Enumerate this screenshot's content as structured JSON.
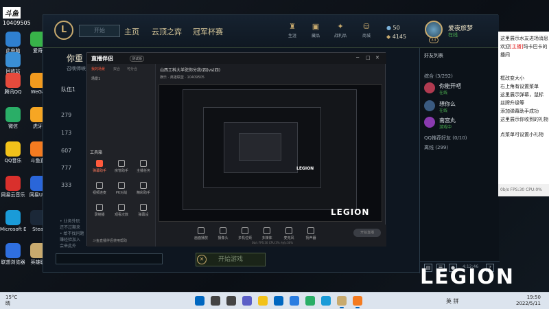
{
  "watermark": {
    "brand": "斗鱼",
    "room": "10409505"
  },
  "desktop_icons": [
    {
      "label": "此电脑",
      "icon": "pc-icon",
      "color": "#2f80d0"
    },
    {
      "label": "回收站",
      "icon": "recycle-bin-icon",
      "color": "#3a8fd6"
    },
    {
      "label": "腾讯QQ",
      "icon": "qq-icon",
      "color": "#e64a3c"
    },
    {
      "label": "微信",
      "icon": "wechat-icon",
      "color": "#2aae67"
    },
    {
      "label": "QQ音乐",
      "icon": "qqmusic-icon",
      "color": "#f2c21a"
    },
    {
      "label": "网易云音乐",
      "icon": "netease-music-icon",
      "color": "#d9302c"
    },
    {
      "label": "Microsoft Edge",
      "icon": "edge-icon",
      "color": "#1a9bd8"
    },
    {
      "label": "联想浏览器",
      "icon": "lenovo-browser-icon",
      "color": "#2f6fe0"
    },
    {
      "label": "爱奇",
      "icon": "iqiyi-icon",
      "color": "#38b349"
    },
    {
      "label": "WeGa",
      "icon": "wegame-icon",
      "color": "#f29a1e"
    },
    {
      "label": "虎牙",
      "icon": "huya-icon",
      "color": "#f6a623"
    },
    {
      "label": "斗鱼直",
      "icon": "douyu-icon",
      "color": "#f47b20"
    },
    {
      "label": "网易UU",
      "icon": "uu-icon",
      "color": "#2a66d9"
    },
    {
      "label": "Stea",
      "icon": "steam-icon",
      "color": "#1b2838"
    },
    {
      "label": "英雄联",
      "icon": "lol-icon",
      "color": "#c8aa6e"
    }
  ],
  "client": {
    "play_label": "开始",
    "nav": [
      "主页",
      "云顶之弈",
      "冠军杯赛"
    ],
    "top_icons": [
      {
        "label": "生涯",
        "icon": "profile-icon"
      },
      {
        "label": "藏品",
        "icon": "collection-icon"
      },
      {
        "label": "战利品",
        "icon": "loot-icon"
      },
      {
        "label": "商城",
        "icon": "store-icon"
      }
    ],
    "currency": {
      "be": "50",
      "rp": "4145"
    },
    "player": {
      "name": "爱夜旅梦",
      "status": "在线",
      "level": "33"
    },
    "party": {
      "title": "你重",
      "subtitle": "召唤师峡",
      "team": "队伍1",
      "numbers": [
        "279",
        "173",
        "607",
        "777",
        "333"
      ]
    },
    "party_chat": [
      "• 业务外玩",
      "还不过期来",
      "• 给不找问题",
      "赚经验加入",
      "会来此外"
    ],
    "start_label": "开始游戏",
    "friends": {
      "header": "好友列表",
      "group_general": "综合 (3/292)",
      "list": [
        {
          "name": "你能开吧",
          "status": "在线",
          "color": "#b03a50"
        },
        {
          "name": "想你么",
          "status": "在线",
          "color": "#3a5a80"
        },
        {
          "name": "南宫丸",
          "status": "游戏中",
          "color": "#8a3ab0"
        }
      ],
      "group_qq": "QQ推荐好友 (0/10)",
      "group_offline": "离线 (299)",
      "bottom_time": "4:12:46"
    }
  },
  "chat_lines": [
    {
      "text": "这里展示水友进场消息",
      "red": false
    },
    {
      "text": "欢迎",
      "red": false
    },
    {
      "text": "[主播]",
      "red": true
    },
    {
      "text": "玛卡巴卡的",
      "red": false
    },
    {
      "text": "播间",
      "red": false
    },
    {
      "text": "",
      "red": false
    },
    {
      "text": "框改变大小",
      "red": false
    },
    {
      "text": "右上角有设置菜单",
      "red": false
    },
    {
      "text": "这里展示弹幕，鼠标",
      "red": false
    },
    {
      "text": "丝牌升级等",
      "red": false
    },
    {
      "text": "添加弹幕助手成功",
      "red": false
    },
    {
      "text": "这里展示你收到的礼物",
      "red": false
    },
    {
      "text": "",
      "red": false
    },
    {
      "text": "点菜单可设置小礼物",
      "red": false
    }
  ],
  "chat_status": "0b/s  FPS:30  CPU:0%",
  "stream": {
    "logo": "直播伴侣",
    "version": "测试版",
    "left_tabs": [
      "我的场景",
      "双合",
      "可分合"
    ],
    "scene": "场景1",
    "tools_title": "工具箱",
    "tools": [
      "弹幕助手",
      "房管助手",
      "主播任务",
      "视频连麦",
      "PK对战",
      "精彩助手",
      "录制播",
      "观看次数",
      "弹幕设"
    ],
    "footer": "斗鱼直播伴侣使用帮助",
    "title": "山西工科大羊驼你分我(四)vs(四)",
    "tags": "娱乐 · 英雄联盟 · 10409505",
    "bottom_buttons": [
      "画面播放",
      "摄像头",
      "多机位频",
      "多媒体",
      "麦克风",
      "扬声器"
    ],
    "go_live": "开始直播",
    "status": "0b/s  FPS:30  CPU:3%  内存:30%"
  },
  "preview": {
    "legion": "LEGION"
  },
  "legion": "LEGION",
  "taskbar": {
    "weather_temp": "15°C",
    "weather_text": "晴",
    "tray": "英  拼",
    "time": "19:50",
    "date": "2022/5/11",
    "apps": [
      {
        "icon": "windows-start-icon",
        "color": "#0067c0"
      },
      {
        "icon": "search-icon",
        "color": "#444"
      },
      {
        "icon": "task-view-icon",
        "color": "#444"
      },
      {
        "icon": "chat-icon",
        "color": "#5b5fc7"
      },
      {
        "icon": "file-explorer-icon",
        "color": "#f2c21a"
      },
      {
        "icon": "store-icon",
        "color": "#0067c0"
      },
      {
        "icon": "qq-browser-icon",
        "color": "#2a7de1"
      },
      {
        "icon": "wechat-icon",
        "color": "#2aae67"
      },
      {
        "icon": "edge-icon",
        "color": "#1a9bd8"
      },
      {
        "icon": "lol-client-icon",
        "color": "#c8aa6e"
      },
      {
        "icon": "douyu-icon",
        "color": "#f47b20"
      }
    ]
  }
}
